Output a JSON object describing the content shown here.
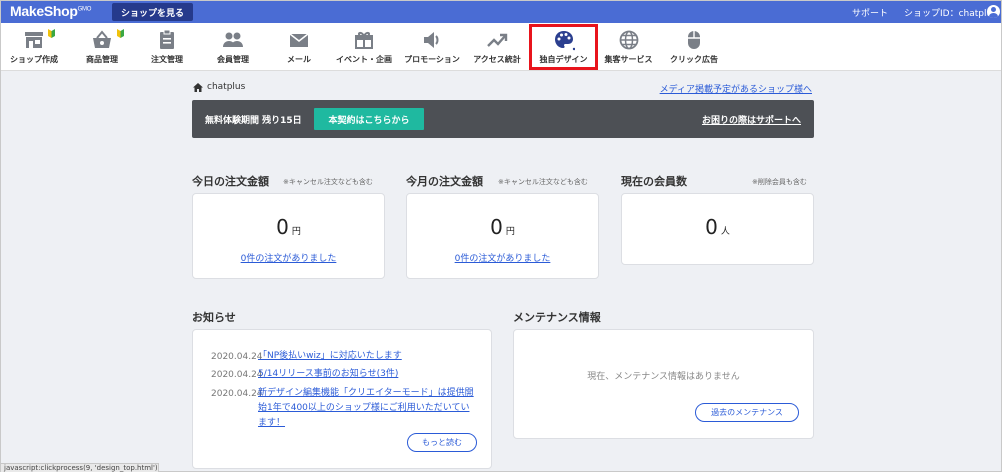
{
  "header": {
    "logo": "MakeShop",
    "logo_suffix": "GMO",
    "view_shop_label": "ショップを見る",
    "support_label": "サポート",
    "shop_id_label": "ショップID：chatplus"
  },
  "nav": {
    "items": [
      {
        "label": "ショップ作成",
        "icon": "shop-icon"
      },
      {
        "label": "商品管理",
        "icon": "basket-icon"
      },
      {
        "label": "注文管理",
        "icon": "clipboard-icon"
      },
      {
        "label": "会員管理",
        "icon": "people-icon"
      },
      {
        "label": "メール",
        "icon": "mail-icon"
      },
      {
        "label": "イベント・企画",
        "icon": "gift-icon"
      },
      {
        "label": "プロモーション",
        "icon": "speaker-icon"
      },
      {
        "label": "アクセス統計",
        "icon": "trend-icon"
      },
      {
        "label": "独自デザイン",
        "icon": "palette-icon"
      },
      {
        "label": "集客サービス",
        "icon": "globe-icon"
      },
      {
        "label": "クリック広告",
        "icon": "mouse-icon"
      }
    ],
    "accent": "#e8141c"
  },
  "breadcrumb": {
    "current": "chatplus"
  },
  "media_link": "メディア掲載予定があるショップ様へ",
  "trial": {
    "text": "無料体験期間 残り15日",
    "contract_button": "本契約はこちらから",
    "help_link": "お困りの際はサポートへ"
  },
  "stats": {
    "today": {
      "title": "今日の注文金額",
      "note": "※キャンセル注文なども含む",
      "value": "0",
      "unit": "円",
      "link": "0件の注文がありました"
    },
    "month": {
      "title": "今月の注文金額",
      "note": "※キャンセル注文なども含む",
      "value": "0",
      "unit": "円",
      "link": "0件の注文がありました"
    },
    "members": {
      "title": "現在の会員数",
      "note": "※削除会員も含む",
      "value": "0",
      "unit": "人"
    }
  },
  "news": {
    "title": "お知らせ",
    "items": [
      {
        "date": "2020.04.24",
        "text": "「NP後払いwiz」に対応いたします"
      },
      {
        "date": "2020.04.24",
        "text": "5/14リリース事前のお知らせ(3件)"
      },
      {
        "date": "2020.04.24",
        "text": "新デザイン編集機能「クリエイターモード」は提供開始1年で400以上のショップ様にご利用いただいています！"
      }
    ],
    "more_label": "もっと読む"
  },
  "maintenance": {
    "title": "メンテナンス情報",
    "empty": "現在、メンテナンス情報はありません",
    "past_label": "過去のメンテナンス"
  },
  "status_bar": "javascript:clickprocess(9, 'design_top.html');",
  "colors": {
    "header": "#4a6cd4",
    "link": "#2b5bd7",
    "cta": "#1fb9a0",
    "trial_bg": "#4d5055"
  }
}
